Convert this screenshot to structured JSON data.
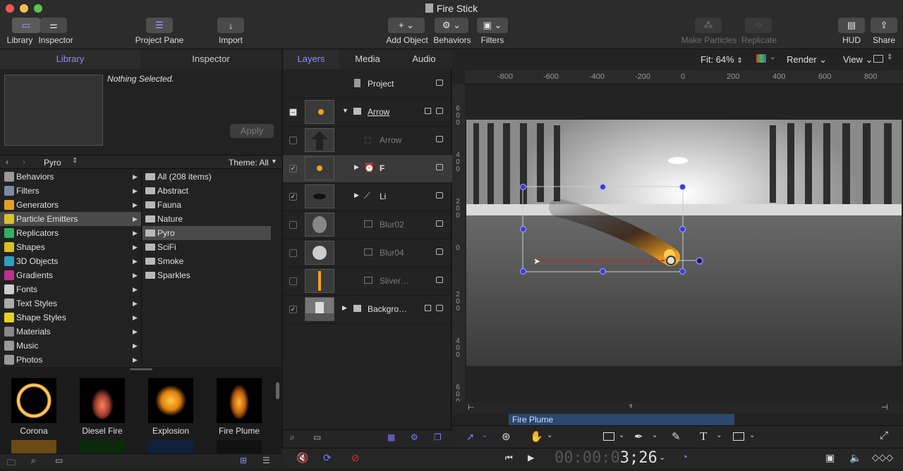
{
  "window": {
    "title": "Fire Stick"
  },
  "toolbar": {
    "library": "Library",
    "inspector": "Inspector",
    "project_pane": "Project Pane",
    "import": "Import",
    "add_object": "Add Object",
    "behaviors": "Behaviors",
    "filters": "Filters",
    "make_particles": "Make Particles",
    "replicate": "Replicate",
    "hud": "HUD",
    "share": "Share"
  },
  "left_tabs": {
    "library": "Library",
    "inspector": "Inspector"
  },
  "library": {
    "nothing_selected": "Nothing Selected.",
    "apply": "Apply",
    "nav_folder": "Pyro",
    "theme": "Theme: All",
    "categories": [
      {
        "label": "Behaviors",
        "color": "#9a9a9a"
      },
      {
        "label": "Filters",
        "color": "#7a8aa0"
      },
      {
        "label": "Generators",
        "color": "#e6a020"
      },
      {
        "label": "Particle Emitters",
        "color": "#d8c030"
      },
      {
        "label": "Replicators",
        "color": "#30b060"
      },
      {
        "label": "Shapes",
        "color": "#d8c020"
      },
      {
        "label": "3D Objects",
        "color": "#30a0c0"
      },
      {
        "label": "Gradients",
        "color": "#c03090"
      },
      {
        "label": "Fonts",
        "color": "#cccccc"
      },
      {
        "label": "Text Styles",
        "color": "#aaaaaa"
      },
      {
        "label": "Shape Styles",
        "color": "#e8d020"
      },
      {
        "label": "Materials",
        "color": "#888888"
      },
      {
        "label": "Music",
        "color": "#999999"
      },
      {
        "label": "Photos",
        "color": "#999999"
      }
    ],
    "subfolders": [
      "All (208 items)",
      "Abstract",
      "Fauna",
      "Nature",
      "Pyro",
      "SciFi",
      "Smoke",
      "Sparkles"
    ],
    "thumbnails": [
      "Corona",
      "Diesel Fire",
      "Explosion",
      "Fire Plume"
    ]
  },
  "layer_tabs": {
    "layers": "Layers",
    "media": "Media",
    "audio": "Audio"
  },
  "layers": [
    {
      "name": "Project"
    },
    {
      "name": "Arrow"
    },
    {
      "name": "Arrow"
    },
    {
      "name": "F"
    },
    {
      "name": "Li"
    },
    {
      "name": "Blur02"
    },
    {
      "name": "Blur04"
    },
    {
      "name": "Sliver…"
    },
    {
      "name": "Backgro…"
    }
  ],
  "canvas": {
    "fit": "Fit: 64%",
    "render": "Render",
    "view": "View",
    "ruler_ticks": [
      "-800",
      "-600",
      "-400",
      "-200",
      "0",
      "200",
      "400",
      "600",
      "800"
    ],
    "vruler_ticks": [
      "600",
      "400",
      "200",
      "0",
      "200",
      "400",
      "600"
    ]
  },
  "timeline": {
    "clip_label": "Fire Plume"
  },
  "transport": {
    "timecode_dim": "00:00:0",
    "timecode": "3;26"
  },
  "colors": {
    "accent": "#7b7bff",
    "fire": "#f0a020",
    "clip": "#2b4870"
  }
}
